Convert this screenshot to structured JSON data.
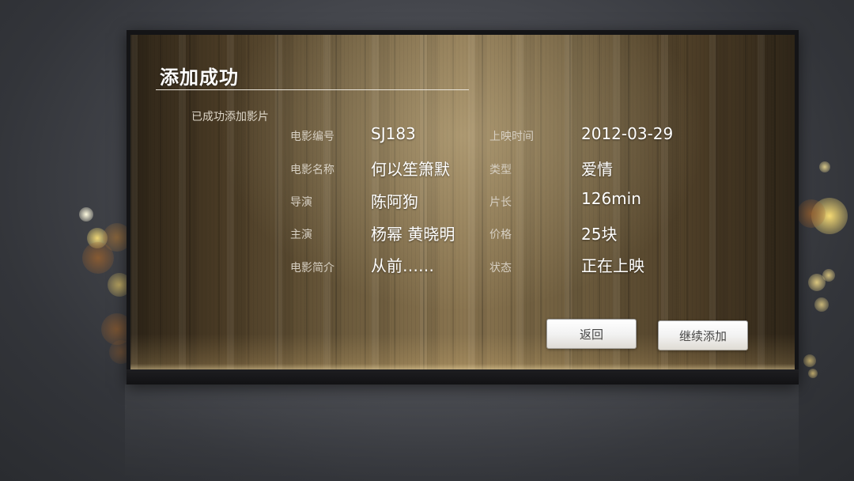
{
  "dialog": {
    "title": "添加成功",
    "subtitle": "已成功添加影片"
  },
  "movie": {
    "left": [
      {
        "label": "电影编号",
        "value": "SJ183"
      },
      {
        "label": "电影名称",
        "value": "何以笙箫默"
      },
      {
        "label": "导演",
        "value": "陈阿狗"
      },
      {
        "label": "主演",
        "value": "杨幂 黄晓明"
      },
      {
        "label": "电影简介",
        "value": "从前……"
      }
    ],
    "right": [
      {
        "label": "上映时间",
        "value": "2012-03-29"
      },
      {
        "label": "类型",
        "value": "爱情"
      },
      {
        "label": "片长",
        "value": "126min"
      },
      {
        "label": "价格",
        "value": "25块"
      },
      {
        "label": "状态",
        "value": "正在上映"
      }
    ]
  },
  "buttons": {
    "back_label": "返回",
    "continue_label": "继续添加"
  },
  "colors": {
    "wood_base": "#5b4a30",
    "wood_light": "#8a7550",
    "frame": "#141416",
    "text_value": "#ffffff",
    "text_label": "#d6cfc2",
    "bokeh_gold": "#f5d36a"
  }
}
